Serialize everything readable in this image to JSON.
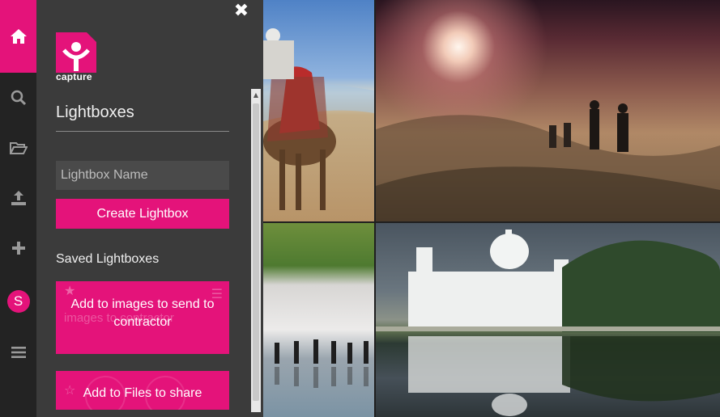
{
  "nav": {
    "items": [
      {
        "name": "home",
        "icon": "home-icon"
      },
      {
        "name": "search",
        "icon": "search-icon"
      },
      {
        "name": "folder",
        "icon": "folder-open-icon"
      },
      {
        "name": "upload",
        "icon": "upload-icon"
      },
      {
        "name": "add",
        "icon": "plus-icon"
      },
      {
        "name": "user",
        "icon": "avatar"
      },
      {
        "name": "menu",
        "icon": "hamburger-icon"
      }
    ],
    "avatar_letter": "S"
  },
  "panel": {
    "close_glyph": "✖",
    "logo_text": "capture",
    "title": "Lightboxes",
    "name_input": {
      "placeholder": "Lightbox Name",
      "value": ""
    },
    "create_label": "Create Lightbox",
    "saved_title": "Saved Lightboxes",
    "saved": [
      {
        "label": "Add to images to send to contractor",
        "ghost_text": "images to contractor"
      },
      {
        "label": "Add to Files to share"
      }
    ]
  },
  "colors": {
    "accent": "#e4137a",
    "rail": "#232323",
    "panel": "#3b3b3b"
  },
  "photos": [
    {
      "name": "camel-rider-desert"
    },
    {
      "name": "foggy-hill-silhouettes"
    },
    {
      "name": "people-walking-salt-flat"
    },
    {
      "name": "white-palace-reflection"
    }
  ]
}
